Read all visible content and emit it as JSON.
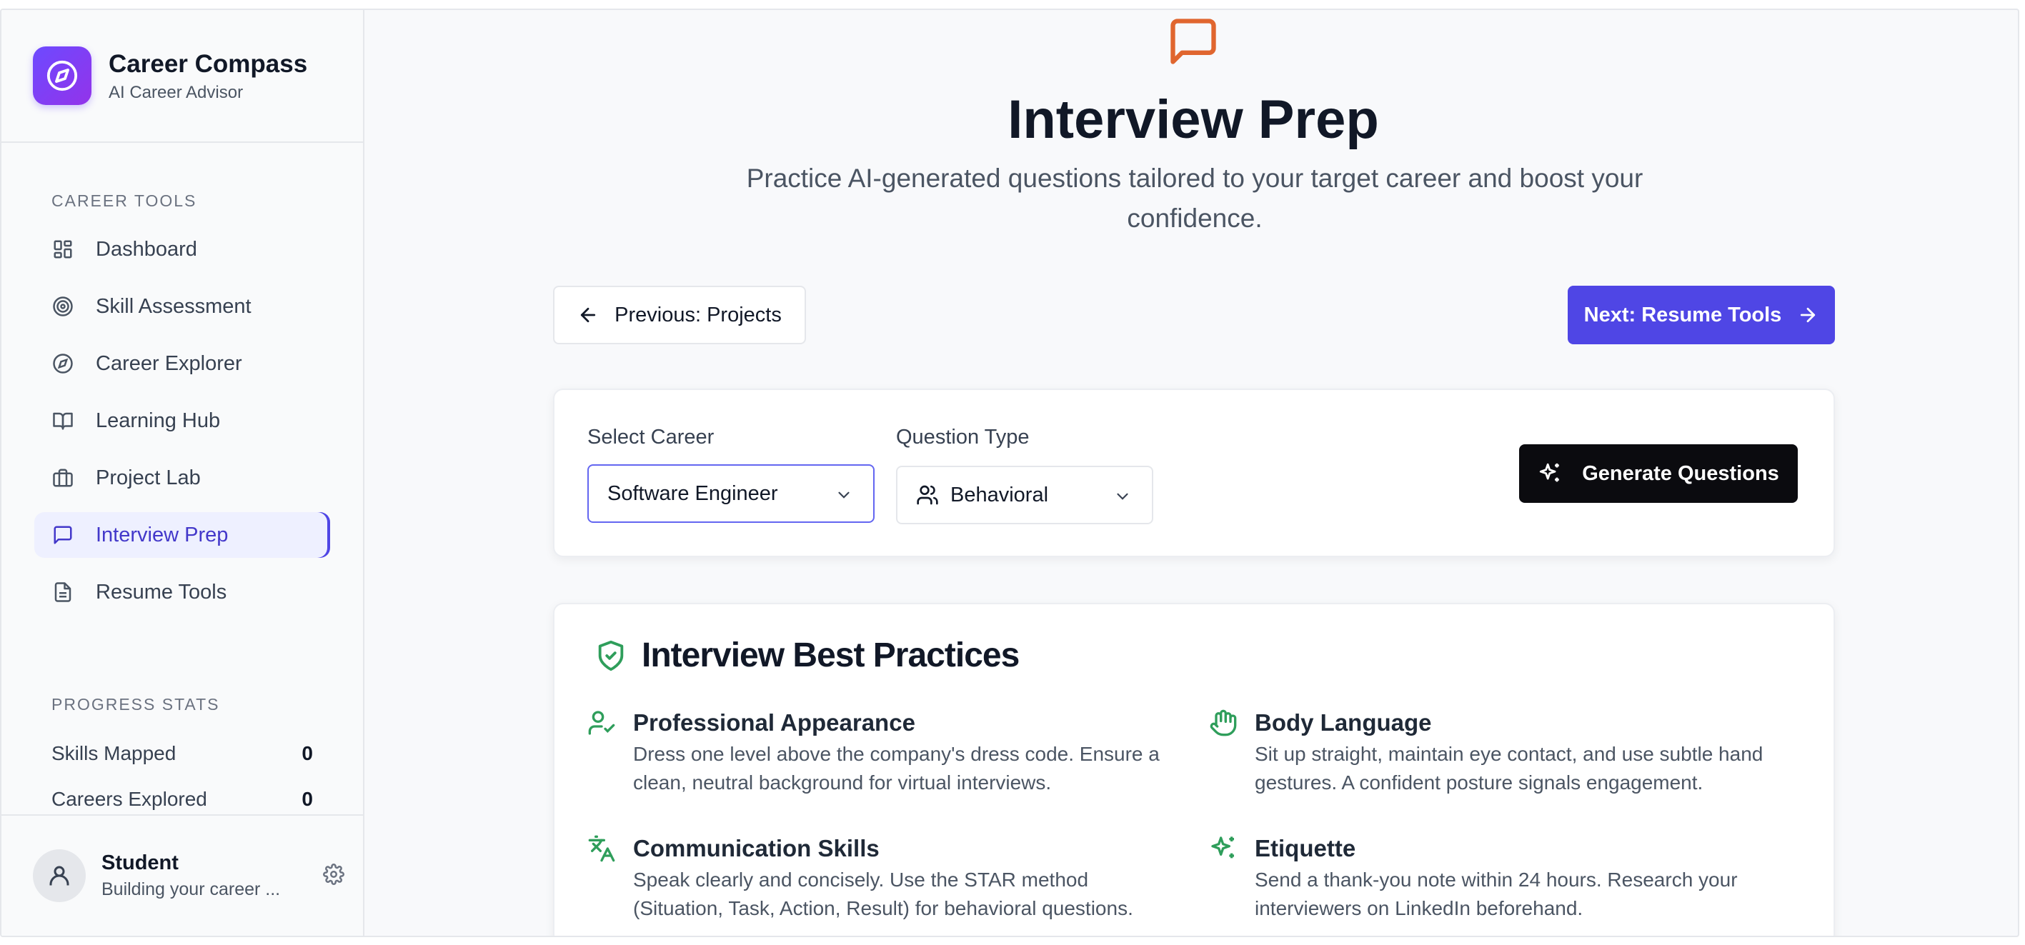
{
  "brand": {
    "title": "Career Compass",
    "subtitle": "AI Career Advisor",
    "logo_icon": "compass-icon"
  },
  "sidebar": {
    "tools_label": "CAREER TOOLS",
    "items": [
      {
        "label": "Dashboard",
        "icon": "dashboard-icon"
      },
      {
        "label": "Skill Assessment",
        "icon": "target-icon"
      },
      {
        "label": "Career Explorer",
        "icon": "compass-icon"
      },
      {
        "label": "Learning Hub",
        "icon": "book-icon"
      },
      {
        "label": "Project Lab",
        "icon": "briefcase-icon"
      },
      {
        "label": "Interview Prep",
        "icon": "message-icon",
        "active": true
      },
      {
        "label": "Resume Tools",
        "icon": "document-icon"
      }
    ],
    "stats_label": "PROGRESS STATS",
    "stats": [
      {
        "label": "Skills Mapped",
        "value": "0"
      },
      {
        "label": "Careers Explored",
        "value": "0"
      }
    ]
  },
  "user": {
    "name": "Student",
    "subtitle": "Building your career ..."
  },
  "page": {
    "title": "Interview Prep",
    "subtitle": "Practice AI-generated questions tailored to your target career and boost your confidence.",
    "prev_button": "Previous: Projects",
    "next_button": "Next: Resume Tools"
  },
  "form": {
    "career_label": "Select Career",
    "career_value": "Software Engineer",
    "type_label": "Question Type",
    "type_value": "Behavioral",
    "generate_button": "Generate Questions"
  },
  "practices": {
    "title": "Interview Best Practices",
    "tips": [
      {
        "title": "Professional Appearance",
        "body": "Dress one level above the company's dress code. Ensure a clean, neutral background for virtual interviews.",
        "icon": "user-check-icon"
      },
      {
        "title": "Body Language",
        "body": "Sit up straight, maintain eye contact, and use subtle hand gestures. A confident posture signals engagement.",
        "icon": "hand-icon"
      },
      {
        "title": "Communication Skills",
        "body": "Speak clearly and concisely. Use the STAR method (Situation, Task, Action, Result) for behavioral questions.",
        "icon": "translate-icon"
      },
      {
        "title": "Etiquette",
        "body": "Send a thank-you note within 24 hours. Research your interviewers on LinkedIn beforehand.",
        "icon": "sparkles-icon"
      }
    ]
  },
  "colors": {
    "accent": "#4f46e5",
    "hero_icon": "#e0662f",
    "tip_icon": "#2f9e5b"
  }
}
